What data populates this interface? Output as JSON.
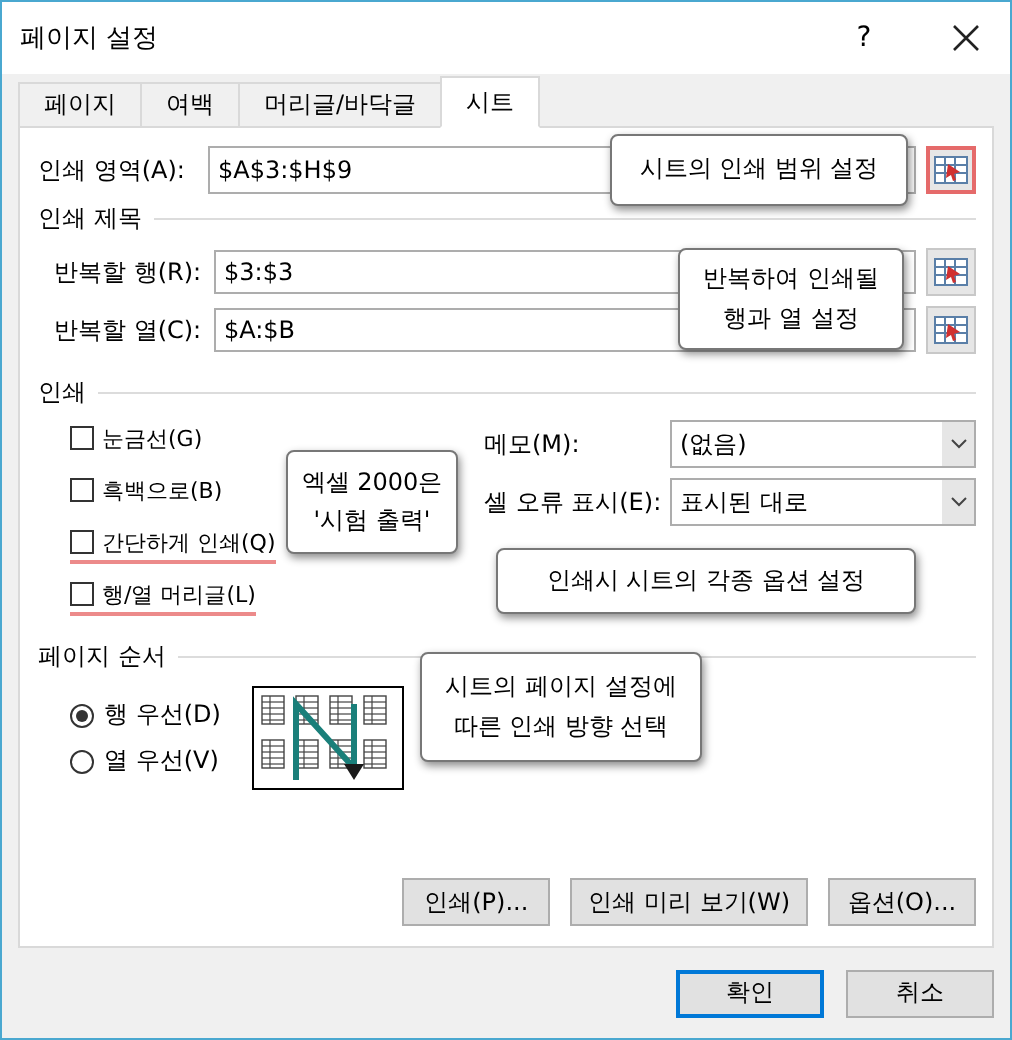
{
  "window": {
    "title": "페이지 설정",
    "help": "?"
  },
  "tabs": [
    {
      "label": "페이지",
      "selected": false
    },
    {
      "label": "여백",
      "selected": false
    },
    {
      "label": "머리글/바닥글",
      "selected": false
    },
    {
      "label": "시트",
      "selected": true
    }
  ],
  "print_area": {
    "label": "인쇄 영역(A):",
    "value": "$A$3:$H$9",
    "highlighted": true
  },
  "print_titles": {
    "heading": "인쇄 제목",
    "rows": [
      {
        "label": "반복할 행(R):",
        "value": "$3:$3",
        "highlighted": false
      },
      {
        "label": "반복할 열(C):",
        "value": "$A:$B",
        "highlighted": false
      }
    ]
  },
  "print": {
    "heading": "인쇄",
    "checkboxes": [
      {
        "label": "눈금선(G)",
        "checked": false,
        "highlighted": false
      },
      {
        "label": "흑백으로(B)",
        "checked": false,
        "highlighted": false
      },
      {
        "label": "간단하게 인쇄(Q)",
        "checked": false,
        "highlighted": true
      },
      {
        "label": "행/열 머리글(L)",
        "checked": false,
        "highlighted": true
      }
    ],
    "dropdowns": [
      {
        "label": "메모(M):",
        "value": "(없음)"
      },
      {
        "label": "셀 오류 표시(E):",
        "value": "표시된 대로"
      }
    ]
  },
  "page_order": {
    "heading": "페이지 순서",
    "options": [
      {
        "label": "행 우선(D)",
        "selected": true
      },
      {
        "label": "열 우선(V)",
        "selected": false
      }
    ]
  },
  "action_buttons": [
    "인쇄(P)...",
    "인쇄 미리 보기(W)",
    "옵션(O)..."
  ],
  "dialog_buttons": [
    {
      "label": "확인",
      "default": true
    },
    {
      "label": "취소",
      "default": false
    }
  ],
  "callouts": [
    {
      "text": "시트의 인쇄 범위 설정"
    },
    {
      "text": "반복하여 인쇄될\n행과 열 설정"
    },
    {
      "text": "엑셀 2000은\n'시험 출력'"
    },
    {
      "text": "인쇄시 시트의 각종 옵션 설정"
    },
    {
      "text": "시트의 페이지 설정에\n따른 인쇄 방향 선택"
    }
  ]
}
